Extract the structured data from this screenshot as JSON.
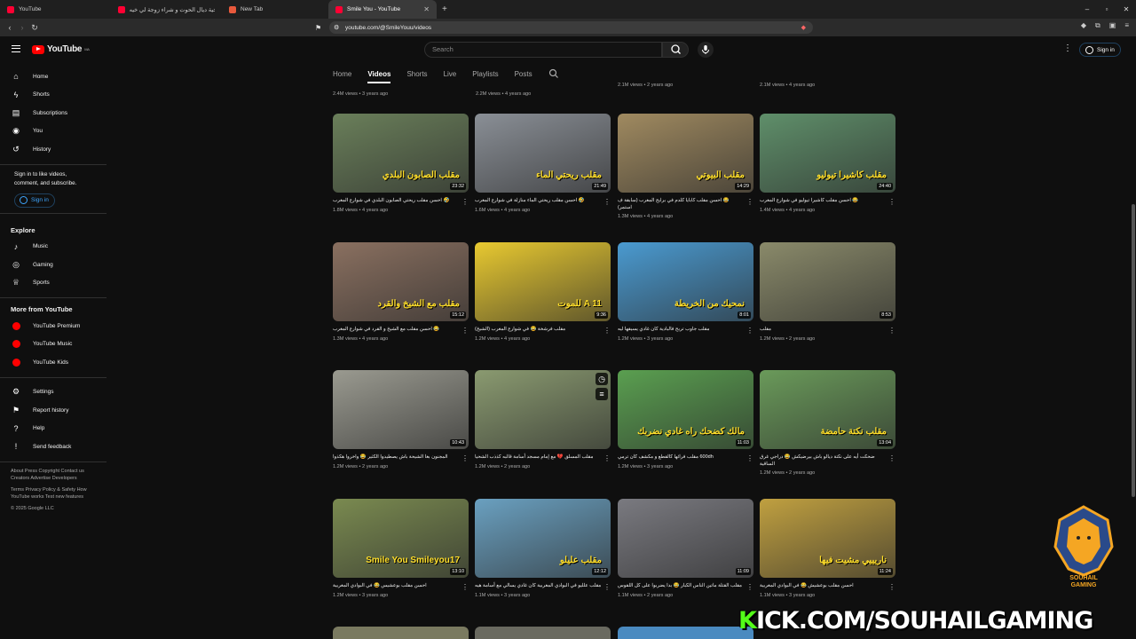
{
  "browser": {
    "tabs": [
      {
        "title": "YouTube",
        "color": "#ff0033"
      },
      {
        "title": "طنجية ديال الحوت و شراء زوجة لي خيه...",
        "color": "#ff0033"
      },
      {
        "title": "New Tab",
        "color": "#e8593c"
      },
      {
        "title": "Smile You - YouTube",
        "color": "#ff0033"
      }
    ],
    "url": "youtube.com/@SmileYouu/videos"
  },
  "header": {
    "logo": "YouTube",
    "logo_sup": "MA",
    "search_placeholder": "Search",
    "signin": "Sign in"
  },
  "sidebar": {
    "main": [
      "Home",
      "Shorts",
      "Subscriptions",
      "You",
      "History"
    ],
    "signin_prompt": "Sign in to like videos, comment, and subscribe.",
    "signin_button": "Sign in",
    "explore_title": "Explore",
    "explore": [
      "Music",
      "Gaming",
      "Sports"
    ],
    "more_title": "More from YouTube",
    "more": [
      "YouTube Premium",
      "YouTube Music",
      "YouTube Kids"
    ],
    "bottom": [
      "Settings",
      "Report history",
      "Help",
      "Send feedback"
    ],
    "footer1": "About  Press  Copyright  Contact us  Creators  Advertise  Developers",
    "footer2": "Terms  Privacy  Policy & Safety  How YouTube works  Test new features",
    "copyright": "© 2025 Google LLC"
  },
  "channel_tabs": [
    "Home",
    "Videos",
    "Shorts",
    "Live",
    "Playlists",
    "Posts"
  ],
  "prev_row_meta": [
    "2.4M views • 3 years ago",
    "2.2M views • 4 years ago",
    "2.1M views • 2 years ago",
    "2.1M views • 4 years ago"
  ],
  "videos": [
    {
      "title": "🤣 احسن مقلب ريحتي الصابون البلدي في شوارع المغرب",
      "meta": "1.8M views • 4 years ago",
      "dur": "23:32",
      "overlay": "مقلب الصابون البلدي",
      "bg": "#6a7f5a"
    },
    {
      "title": "🤣 احسن مقلب ريحتي الماء منازلة في شوارع المغرب",
      "meta": "1.6M views • 4 years ago",
      "dur": "21:49",
      "overlay": "مقلب ريحتي الماء",
      "bg": "#8a8f96"
    },
    {
      "title": "😂 احسن مقلب كابايا كلدم في برايح المغرب (سابقة ف استمر)",
      "meta": "1.3M views • 4 years ago",
      "dur": "14:29",
      "overlay": "مقلب البيوتي",
      "bg": "#a08a60"
    },
    {
      "title": "😂 احسن مقلب كاشيرا تيوليو في شوارع المغرب",
      "meta": "1.4M views • 4 years ago",
      "dur": "24:40",
      "overlay": "مقلب كاشيرا تيوليو",
      "bg": "#5f8f6a"
    },
    {
      "title": "😂 احسن مقلب مع الشيخ و القرد في شوارع المغرب",
      "meta": "1.3M views • 4 years ago",
      "dur": "15:12",
      "overlay": "مقلب مع الشيخ والقرد",
      "bg": "#8a7060"
    },
    {
      "title": "مقلب فرشخة 😂 في شوارع المغرب (الشيخ)",
      "meta": "1.2M views • 4 years ago",
      "dur": "9:36",
      "overlay": "A 11 للموت",
      "bg": "#e8c930"
    },
    {
      "title": "مقلب جاوب تربح فالبادية كان غادي يسيقها ليه",
      "meta": "1.2M views • 3 years ago",
      "dur": "8:01",
      "overlay": "نمحيك من الخريطة",
      "bg": "#4a9ad0"
    },
    {
      "title": "مقلب",
      "meta": "1.2M views • 2 years ago",
      "dur": "8:53",
      "overlay": "",
      "bg": "#8a8a6a"
    },
    {
      "title": "المجنون بغا الشيحة باش يصطيدوا الكثير 😂 واخروا هكذوا",
      "meta": "1.2M views • 2 years ago",
      "dur": "10:43",
      "overlay": "",
      "bg": "#9a9a90"
    },
    {
      "title": "مقلب المسلق 💔 مع إمام مسجد أسامة قالبه كذذب الشحيا",
      "meta": "1.2M views • 2 years ago",
      "dur": "",
      "overlay": "",
      "bg": "#8a9a70"
    },
    {
      "title": "600dh مقلب فرائها كالقطع و مكشف كان ترمي",
      "meta": "1.2M views • 3 years ago",
      "dur": "11:03",
      "overlay": "مالك كضحك راه غادي نضربك",
      "bg": "#5a9f50"
    },
    {
      "title": "ضحكت أيه على نكتة ديالو باش بيرضيكش 😂 دراجي غرق الساقية",
      "meta": "1.2M views • 2 years ago",
      "dur": "13:04",
      "overlay": "مقلب نكتة حامضة",
      "bg": "#6a9a5a"
    },
    {
      "title": "احسن مقلب بوعشيس 😂 في البوادي المغربية",
      "meta": "1.2M views • 3 years ago",
      "dur": "13:10",
      "overlay": "Smile You  Smileyou17",
      "bg": "#7a8a50"
    },
    {
      "title": "مقلب علليو في البوادي المغربية كان غادي يسالي مع أسامة هيه",
      "meta": "1.1M views • 3 years ago",
      "dur": "12:12",
      "overlay": "مقلب عليلو",
      "bg": "#6aa0c0"
    },
    {
      "title": "مقلب القتلة ماتين الناس الكبار 😂 بدا يضربوا على كل اللقوس",
      "meta": "1.1M views • 2 years ago",
      "dur": "11:09",
      "overlay": "",
      "bg": "#7a7a80"
    },
    {
      "title": "احسن مقلب بوعشيش 😂 في البوادي المغربية",
      "meta": "1.1M views • 3 years ago",
      "dur": "11:24",
      "overlay": "ناريييي مشيت فيها",
      "bg": "#c0a040"
    }
  ],
  "overlay_brand": {
    "kick": "KICK.COM/SOUHAILGAMING",
    "kick_k": "K",
    "kick_rest": "ICK.COM/SOUHAILGAMING",
    "badge_line1": "SOUHAIL",
    "badge_line2": "GAMING"
  }
}
